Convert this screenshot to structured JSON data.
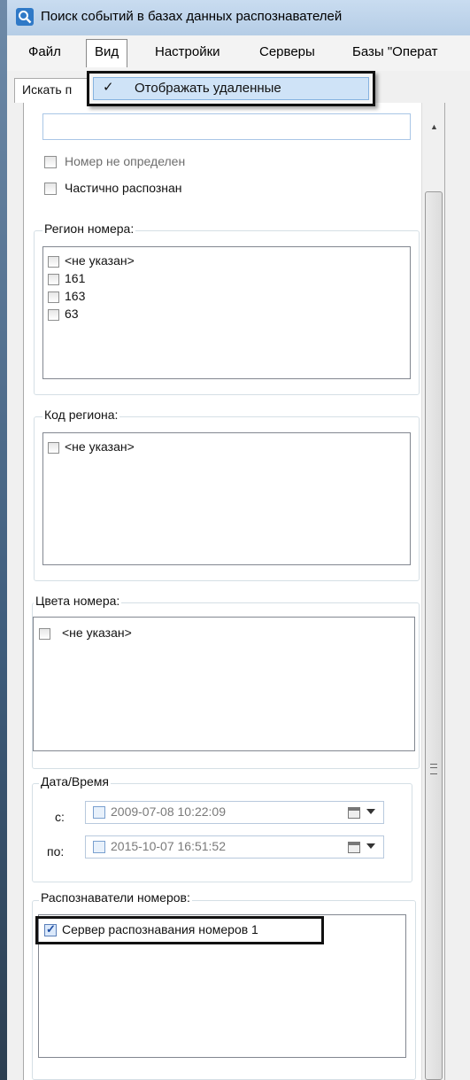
{
  "window": {
    "title": "Поиск событий в базах данных распознавателей"
  },
  "menu": [
    "Файл",
    "Вид",
    "Настройки",
    "Серверы",
    "Базы \"Операт"
  ],
  "tab": {
    "label": "Искать п"
  },
  "dropdown": {
    "item_label": "Отображать удаленные",
    "checked": true
  },
  "checkboxes": {
    "not_determined": "Номер не определен",
    "partial": "Частично распознан"
  },
  "region_group": {
    "title": "Регион номера:",
    "items": [
      "<не указан>",
      "161",
      "163",
      "63"
    ]
  },
  "code_group": {
    "title": "Код региона:",
    "items": [
      "<не указан>"
    ]
  },
  "color_group": {
    "title": "Цвета номера:",
    "items": [
      "<не указан>"
    ]
  },
  "datetime_group": {
    "title": "Дата/Время",
    "from_label": "с:",
    "from_value": "2009-07-08 10:22:09",
    "to_label": "по:",
    "to_value": "2015-10-07 16:51:52"
  },
  "recognizers_group": {
    "title": "Распознаватели номеров:",
    "items": [
      "Сервер распознавания номеров 1"
    ]
  }
}
